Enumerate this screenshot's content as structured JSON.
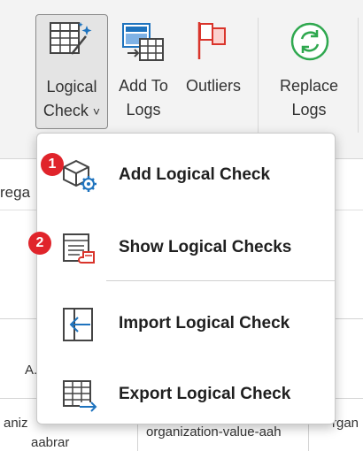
{
  "ribbon": {
    "logical_check": {
      "line1": "Logical",
      "line2": "Check",
      "chevron": "˅",
      "icon": "table-wand-icon"
    },
    "add_to_logs": {
      "line1": "Add To",
      "line2": "Logs",
      "icon": "table-add-icon"
    },
    "outliers": {
      "line1": "Outliers",
      "icon": "flag-icon"
    },
    "replace_logs": {
      "line1": "Replace",
      "line2": "Logs",
      "icon": "refresh-icon"
    }
  },
  "sheet": {
    "partial_left_label": "rega",
    "cell_a": "A.",
    "cell_organiz": "aniz",
    "cell_aabrar": "aabrar",
    "cell_org_value": "organization-value-aah",
    "cell_org_right": "rgan"
  },
  "menu": {
    "items": [
      {
        "label": "Add Logical Check",
        "icon": "cube-gear-icon"
      },
      {
        "label": "Show Logical Checks",
        "icon": "list-document-icon"
      },
      {
        "label": "Import Logical Check",
        "icon": "import-arrow-icon"
      },
      {
        "label": "Export Logical Check",
        "icon": "table-export-icon"
      }
    ]
  },
  "annotations": [
    {
      "number": "1",
      "color": "#e0242b"
    },
    {
      "number": "2",
      "color": "#e0242b"
    }
  ],
  "colors": {
    "accent_blue": "#1e73be",
    "icon_red": "#d9342b",
    "icon_green": "#2fa84f"
  }
}
